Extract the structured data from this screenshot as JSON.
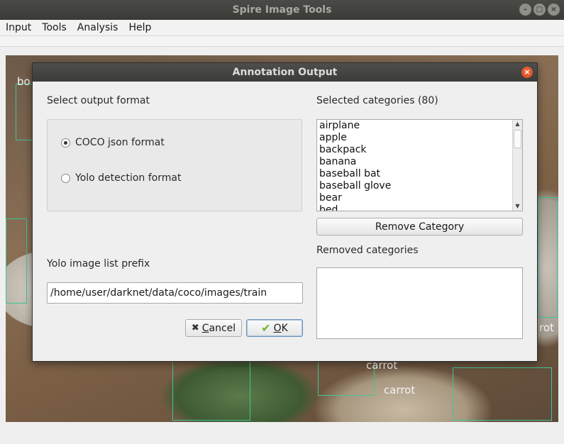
{
  "window": {
    "title": "Spire Image Tools"
  },
  "menu": [
    "Input",
    "Tools",
    "Analysis",
    "Help"
  ],
  "background_labels": [
    "bo",
    "rot",
    "carrot",
    "carrot"
  ],
  "dialog": {
    "title": "Annotation Output",
    "format_section_label": "Select output format",
    "formats": [
      {
        "label": "COCO json format",
        "selected": true
      },
      {
        "label": "Yolo detection format",
        "selected": false
      }
    ],
    "prefix_label": "Yolo image list prefix",
    "prefix_value": "/home/user/darknet/data/coco/images/train",
    "cancel_label": "Cancel",
    "ok_label": "OK",
    "selected_label": "Selected categories (80)",
    "selected_categories": [
      "airplane",
      "apple",
      "backpack",
      "banana",
      "baseball bat",
      "baseball glove",
      "bear",
      "bed"
    ],
    "remove_button_label": "Remove Category",
    "removed_label": "Removed categories",
    "removed_categories": []
  },
  "icons": {
    "cancel": "x-icon",
    "ok": "checkmark-icon",
    "close": "close-icon",
    "minimize": "minimize-icon",
    "maximize": "maximize-icon"
  },
  "colors": {
    "titlebar": "#3c3c39",
    "close_button": "#e3572a",
    "bbox": "#3fc59b",
    "ok_check": "#6fb52f"
  }
}
